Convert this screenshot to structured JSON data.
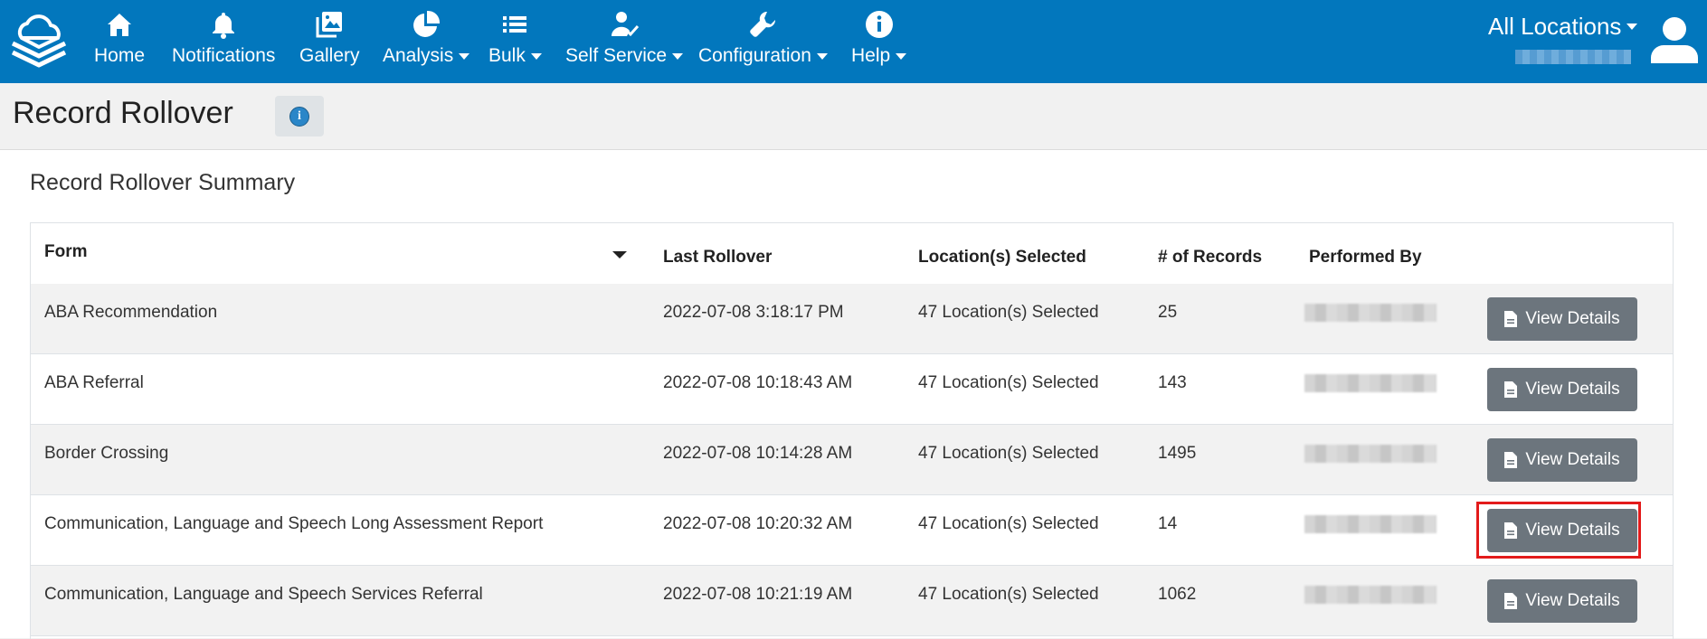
{
  "nav": {
    "items": [
      {
        "label": "Home",
        "icon": "home-icon",
        "dropdown": false
      },
      {
        "label": "Notifications",
        "icon": "bell-icon",
        "dropdown": false
      },
      {
        "label": "Gallery",
        "icon": "gallery-icon",
        "dropdown": false
      },
      {
        "label": "Analysis",
        "icon": "pie-chart-icon",
        "dropdown": true
      },
      {
        "label": "Bulk",
        "icon": "list-icon",
        "dropdown": true
      },
      {
        "label": "Self Service",
        "icon": "user-check-icon",
        "dropdown": true
      },
      {
        "label": "Configuration",
        "icon": "wrench-icon",
        "dropdown": true
      },
      {
        "label": "Help",
        "icon": "info-icon",
        "dropdown": true
      }
    ],
    "location": "All Locations"
  },
  "page": {
    "title": "Record Rollover",
    "section_title": "Record Rollover Summary"
  },
  "table": {
    "columns": [
      "Form",
      "Last Rollover",
      "Location(s) Selected",
      "# of Records",
      "Performed By"
    ],
    "button_label": "View Details",
    "rows": [
      {
        "form": "ABA Recommendation",
        "last_rollover": "2022-07-08 3:18:17 PM",
        "locations": "47 Location(s) Selected",
        "records": "25"
      },
      {
        "form": "ABA Referral",
        "last_rollover": "2022-07-08 10:18:43 AM",
        "locations": "47 Location(s) Selected",
        "records": "143"
      },
      {
        "form": "Border Crossing",
        "last_rollover": "2022-07-08 10:14:28 AM",
        "locations": "47 Location(s) Selected",
        "records": "1495"
      },
      {
        "form": "Communication, Language and Speech Long Assessment Report",
        "last_rollover": "2022-07-08 10:20:32 AM",
        "locations": "47 Location(s) Selected",
        "records": "14"
      },
      {
        "form": "Communication, Language and Speech Services Referral",
        "last_rollover": "2022-07-08 10:21:19 AM",
        "locations": "47 Location(s) Selected",
        "records": "1062"
      }
    ]
  },
  "colors": {
    "navbar": "#0277bd",
    "button": "#6c757d",
    "highlight": "#e31b1b",
    "info": "#2a86c8"
  }
}
